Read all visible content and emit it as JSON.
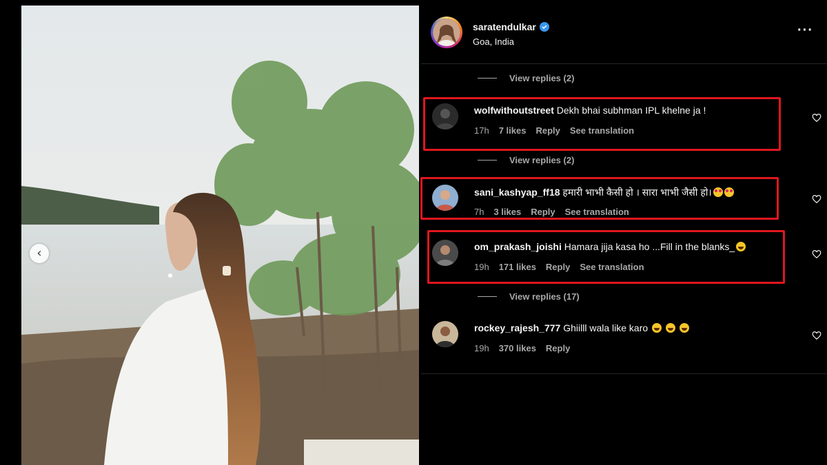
{
  "post": {
    "username": "saratendulkar",
    "location": "Goa, India",
    "more_icon": "more-horizontal-icon",
    "carousel_prev_icon": "chevron-left-icon"
  },
  "comments": [
    {
      "type": "view_replies",
      "label": "View replies (2)"
    },
    {
      "type": "comment",
      "username": "wolfwithoutstreet",
      "text": "Dekh bhai subhman IPL khelne ja !",
      "time": "17h",
      "likes": "7 likes",
      "reply": "Reply",
      "translate": "See translation",
      "highlighted": true
    },
    {
      "type": "view_replies",
      "label": "View replies (2)"
    },
    {
      "type": "comment",
      "username": "sani_kashyap_ff18",
      "text": "हमारी भाभी कैसी हो । सारा भाभी जैसी हो।",
      "time": "7h",
      "likes": "3 likes",
      "reply": "Reply",
      "translate": "See translation",
      "highlighted": true,
      "emojis": [
        "heart-eyes",
        "heart-eyes"
      ]
    },
    {
      "type": "comment",
      "username": "om_prakash_joishi",
      "text": "Hamara jija kasa ho ...Fill in the blanks_",
      "time": "19h",
      "likes": "171 likes",
      "reply": "Reply",
      "translate": "See translation",
      "highlighted": true,
      "emojis": [
        "laugh"
      ]
    },
    {
      "type": "view_replies",
      "label": "View replies (17)"
    },
    {
      "type": "comment",
      "username": "rockey_rajesh_777",
      "text": "Ghiilll wala like karo",
      "time": "19h",
      "likes": "370 likes",
      "reply": "Reply",
      "highlighted": false,
      "emojis": [
        "laugh",
        "laugh",
        "laugh"
      ]
    }
  ],
  "colors": {
    "highlight": "#e0161e",
    "muted": "#a8a8a8",
    "verified": "#3897f0"
  }
}
